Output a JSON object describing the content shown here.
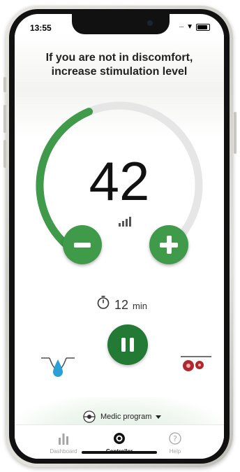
{
  "status_bar": {
    "time": "13:55"
  },
  "instruction": {
    "line1": "If you are not in discomfort,",
    "line2": "increase stimulation level"
  },
  "stimulation": {
    "level": "42",
    "progress_fraction": 0.42
  },
  "timer": {
    "value": "12",
    "unit": "min"
  },
  "program": {
    "label": "Medic program"
  },
  "tabs": [
    {
      "label": "Dashboard",
      "icon": "bar-chart-icon",
      "active": false
    },
    {
      "label": "Controller",
      "icon": "controller-icon",
      "active": true
    },
    {
      "label": "Help",
      "icon": "help-icon",
      "active": false
    }
  ],
  "colors": {
    "accent": "#3f9a4a",
    "accent_dark": "#237a35",
    "track": "#e6e6e6",
    "electrode_red": "#b0282e"
  }
}
